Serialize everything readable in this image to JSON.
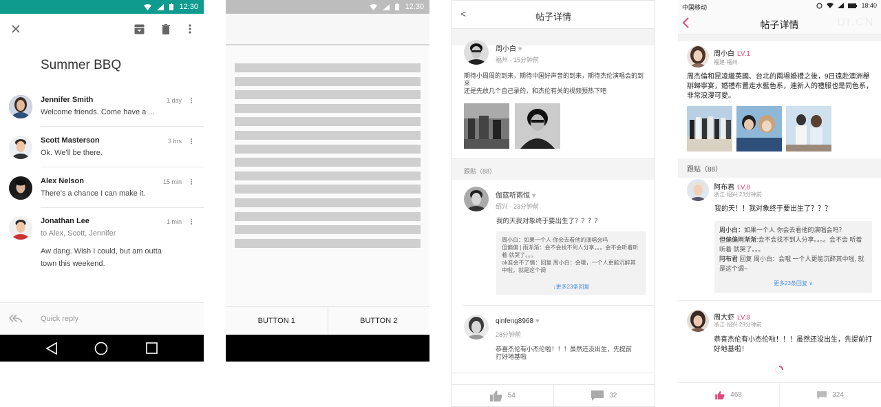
{
  "screen1": {
    "status_time": "12:30",
    "subject": "Summer BBQ",
    "messages": [
      {
        "sender": "Jennifer Smith",
        "time": "1 day",
        "snippet": "Welcome friends. Come have a ..."
      },
      {
        "sender": "Scott Masterson",
        "time": "3 hrs",
        "snippet": "Ok. We'll be there."
      },
      {
        "sender": "Alex Nelson",
        "time": "15 min",
        "snippet": "There's a chance I can make it."
      },
      {
        "sender": "Jonathan Lee",
        "time": "1 min",
        "recipients": "to Alex, Scott, Jennifer",
        "body": "Aw dang. Wish I could, but am outta town this weekend."
      }
    ],
    "quick_reply_placeholder": "Quick reply"
  },
  "screen2": {
    "status_time": "12:30",
    "button1": "BUTTON 1",
    "button2": "BUTTON 2"
  },
  "screen3": {
    "back": "<",
    "title": "帖子详情",
    "post": {
      "author": "周小白",
      "meta": "福州 · 15分钟前",
      "text": "期待小周周的到来，期待中国好声音的到来，期待杰伦演唱会的到来\n还是先放几个自己录的，和杰伦有关的视频预热下吧"
    },
    "replies_label": "跟贴（88）",
    "reply1": {
      "author": "伽蓝听雨恒",
      "meta": "绍兴 · 23分钟前",
      "text": "我的天我对象终于要出生了？？？？",
      "quote": "周小白：如果一个人 你会去看他的演唱会吗\n但偏偏 | 雨渐渐：会不会找不到人分享。。。会不会听着听着 就哭了。。。\nok准会不了情：回复 周小白：会哦，一个人更能沉醉其中啦，就是这个调",
      "more": "↓更多23条回复"
    },
    "reply2": {
      "author": "qinfeng8968",
      "meta": "28分钟前",
      "text": "恭喜杰伦有小杰伦啦！！！虽然还没出生，先提前打好地基啦"
    },
    "likes": "54",
    "comments": "32"
  },
  "screen4": {
    "carrier": "中国移动",
    "status_time": "18:40",
    "title": "帖子详情",
    "watermark": "UI.CN",
    "post": {
      "author": "周小白",
      "level": "LV.1",
      "meta": "福建·福州",
      "text": "周杰倫和昆凌繼英國、台北的兩場婚禮之後，9日遠赴澳洲舉辦歸寧宴，婚禮布置走水藍色系，連新人的禮服也是同色系，非常浪漫可愛。"
    },
    "replies_label": "跟贴（88）",
    "reply1": {
      "author": "阿布君",
      "level": "LV.8",
      "meta": "浙江·绍兴  23分钟前",
      "text": "我的天！！我对象终于要出生了？？？",
      "quote_lines": [
        {
          "name": "周小白：",
          "text": "如果一个人 你会去看他的演唱会吗？"
        },
        {
          "name": "但偏偏雨渐渐",
          "text": ":会不会找不到人分享。。。。会不会 听着听着 就哭了。。。"
        },
        {
          "name": "阿布君",
          "text": " 回复 周小白：会哦 一个人更能沉醉其中啦, 就是这个调~"
        }
      ],
      "more": "更多23条回复 ∨"
    },
    "reply2": {
      "author": "周大虾",
      "level": "LV.8",
      "meta": "浙江·绍兴  29分钟前",
      "text": "恭喜杰伦有小杰伦啦！！！虽然还没出生，先提前打好地基啦！"
    },
    "likes": "468",
    "comments": "324",
    "colors": {
      "accent": "#e2477e",
      "link": "#4a8fe0"
    }
  }
}
